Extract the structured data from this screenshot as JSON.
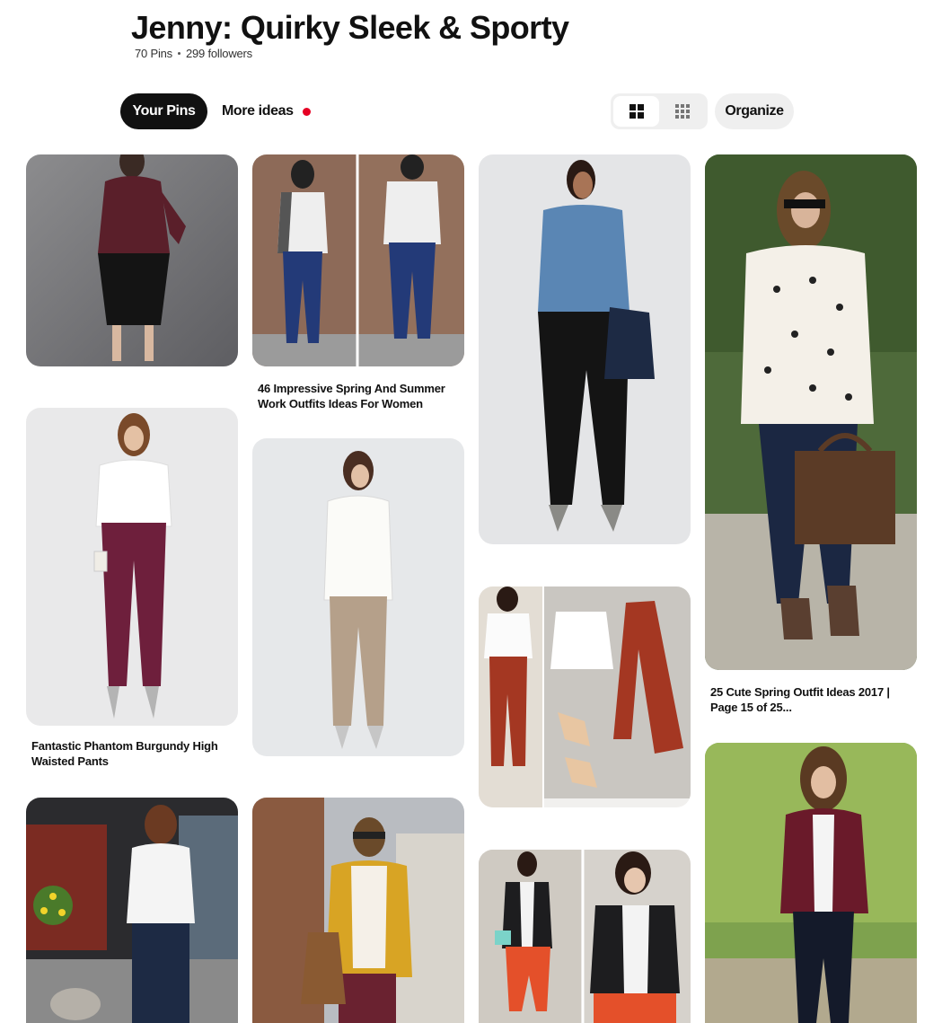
{
  "board": {
    "title": "Jenny: Quirky Sleek & Sporty",
    "pins_count": "70 Pins",
    "followers": "299 followers"
  },
  "tabs": {
    "your_pins": "Your Pins",
    "more_ideas": "More ideas"
  },
  "toolbar": {
    "organize": "Organize",
    "view_default_icon": "grid-large-icon",
    "view_compact_icon": "grid-compact-icon"
  },
  "pins": [
    {
      "image": "burgundy blouse with black pencil skirt",
      "caption": ""
    },
    {
      "image": "striped blazer with navy pants",
      "caption": "46 Impressive Spring And Summer Work Outfits Ideas For Women"
    },
    {
      "image": "denim shirt with black pants",
      "caption": ""
    },
    {
      "image": "polka dot sweater with jeans",
      "caption": "25 Cute Spring Outfit Ideas 2017 | Page 15 of 25..."
    },
    {
      "image": "white shirt with burgundy high waisted pants",
      "caption": "Fantastic Phantom Burgundy High Waisted Pants"
    },
    {
      "image": "white vest with khaki pants",
      "caption": ""
    },
    {
      "image": "white blouse with rust pants flat lay",
      "caption": ""
    },
    {
      "image": "burgundy blazer with dark jeans",
      "caption": ""
    },
    {
      "image": "white bow blouse with jeans",
      "caption": ""
    },
    {
      "image": "mustard cardigan with burgundy pants",
      "caption": ""
    },
    {
      "image": "black blazer with orange pants",
      "caption": ""
    }
  ],
  "colors": {
    "accent": "#e60023",
    "primary_pill": "#111111",
    "secondary_pill": "#efefef"
  }
}
